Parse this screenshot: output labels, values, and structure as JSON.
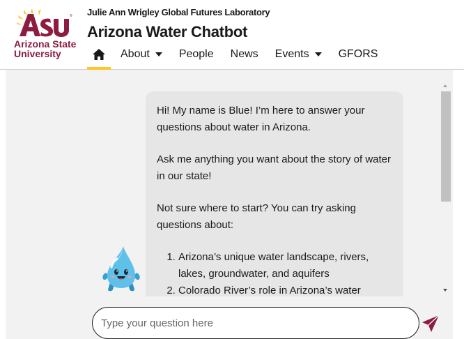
{
  "header": {
    "logo_line1": "Arizona State",
    "logo_line2": "University",
    "lab_name": "Julie Ann Wrigley Global Futures Laboratory",
    "site_title": "Arizona Water Chatbot",
    "nav": {
      "home_icon": "home-icon",
      "about": "About",
      "people": "People",
      "news": "News",
      "events": "Events",
      "gfors": "GFORS"
    }
  },
  "chat": {
    "message": {
      "greeting": "Hi! My name is Blue! I’m here to answer your questions about water in Arizona.",
      "ask": "Ask me anything you want about the story of water in our state!",
      "prompt": "Not sure where to start? You can try asking questions about:",
      "topics": [
        "Arizona’s unique water landscape, rivers, lakes, groundwater, and aquifers",
        "Colorado River’s role in Arizona’s water"
      ]
    },
    "avatar_icon": "water-drop-mascot-icon"
  },
  "input": {
    "placeholder": "Type your question here",
    "send_icon": "send-icon"
  },
  "colors": {
    "maroon": "#8c1d40",
    "gold": "#ffc627",
    "chat_bg": "#f2f2f2",
    "bubble_bg": "#e6e6e6"
  }
}
